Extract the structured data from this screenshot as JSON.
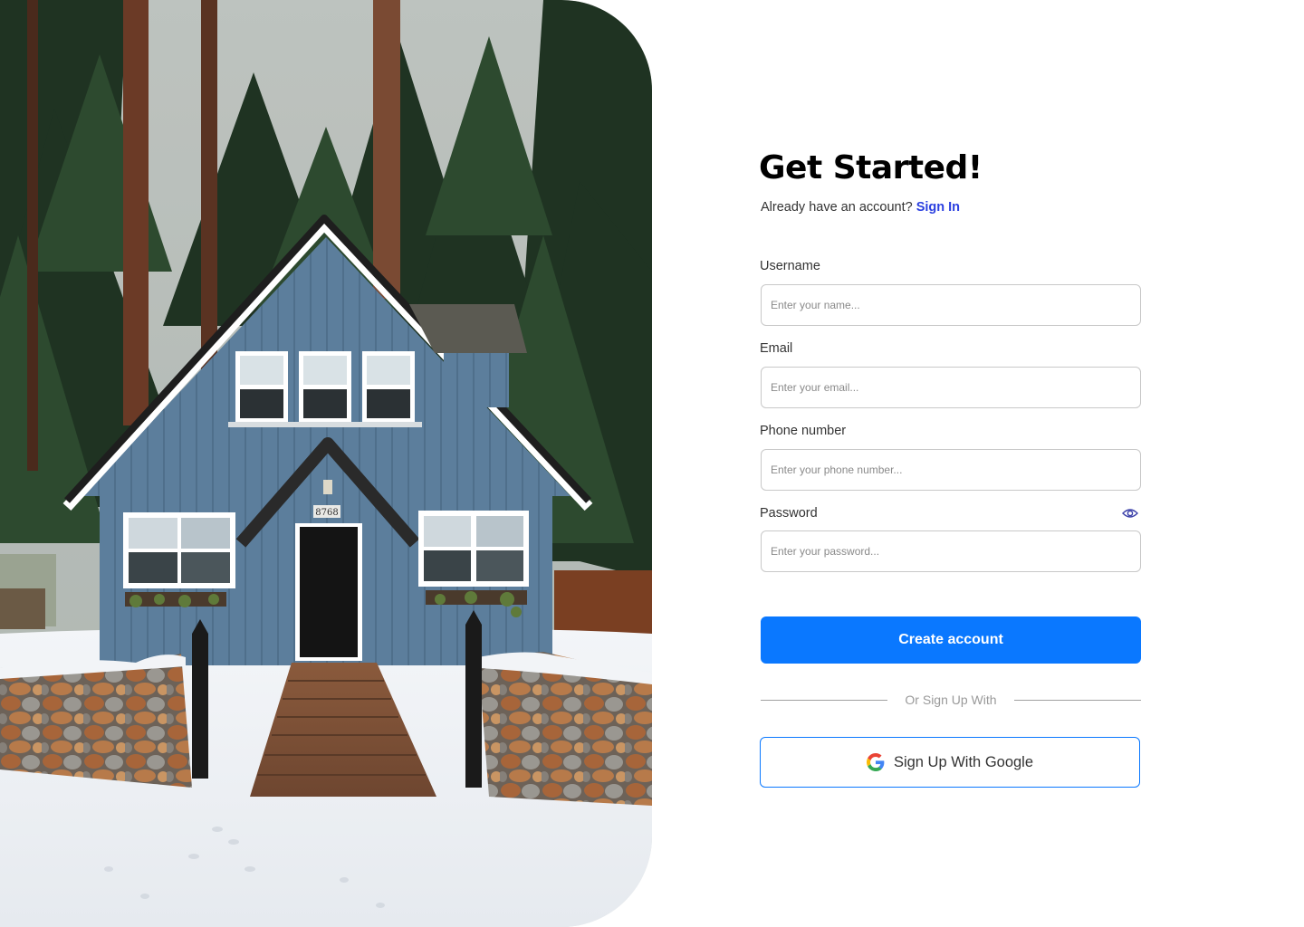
{
  "hero": {
    "house_number": "8768"
  },
  "header": {
    "title": "Get Started!",
    "subtitle_prefix": "Already have an account?",
    "signin_label": "Sign In"
  },
  "form": {
    "fields": [
      {
        "label": "Username",
        "placeholder": "Enter your name...",
        "value": ""
      },
      {
        "label": "Email",
        "placeholder": "Enter your email...",
        "value": ""
      },
      {
        "label": "Phone number",
        "placeholder": "Enter your phone number...",
        "value": ""
      },
      {
        "label": "Password",
        "placeholder": "Enter your password...",
        "value": ""
      }
    ],
    "password_toggle_icon": "eye-icon",
    "submit_label": "Create account",
    "divider_text": "Or Sign Up With",
    "google_label": "Sign Up With Google",
    "google_icon": "google-g-icon"
  },
  "colors": {
    "primary": "#0a78ff",
    "link": "#2a3fe0",
    "title": "#000000",
    "label": "#333333",
    "placeholder": "#8a8a8a",
    "input_border": "#c8c8c8"
  }
}
